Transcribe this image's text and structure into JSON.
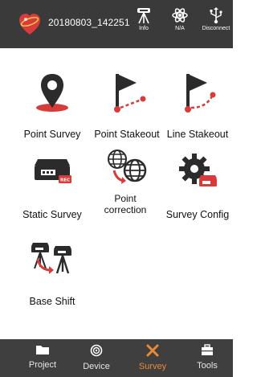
{
  "topbar": {
    "project_name": "20180803_142251",
    "tools": [
      {
        "label": "Info",
        "icon": "gnss-receiver-icon"
      },
      {
        "label": "N/A",
        "icon": "satellite-atom-icon"
      },
      {
        "label": "Disconnect",
        "icon": "usb-plug-icon"
      }
    ]
  },
  "tiles": [
    {
      "label": "Point Survey",
      "icon": "map-pin-icon"
    },
    {
      "label": "Point Stakeout",
      "icon": "flag-point-icon"
    },
    {
      "label": "Line Stakeout",
      "icon": "flag-line-icon"
    },
    {
      "label": "Static Survey",
      "icon": "static-receiver-rec-icon"
    },
    {
      "label_line1": "Point",
      "label_line2": "correction",
      "icon": "globe-correction-icon"
    },
    {
      "label": "Survey Config",
      "icon": "gear-receiver-icon"
    },
    {
      "label": "Base Shift",
      "icon": "base-shift-icon"
    }
  ],
  "nav": {
    "items": [
      {
        "label": "Project",
        "icon": "folder-icon"
      },
      {
        "label": "Device",
        "icon": "device-signal-icon"
      },
      {
        "label": "Survey",
        "icon": "survey-tools-icon"
      },
      {
        "label": "Tools",
        "icon": "toolbox-icon"
      }
    ],
    "active": "Survey"
  },
  "colors": {
    "accent": "#d93a3a",
    "active_nav": "#e88a3a",
    "bar": "#3a3a3a"
  }
}
